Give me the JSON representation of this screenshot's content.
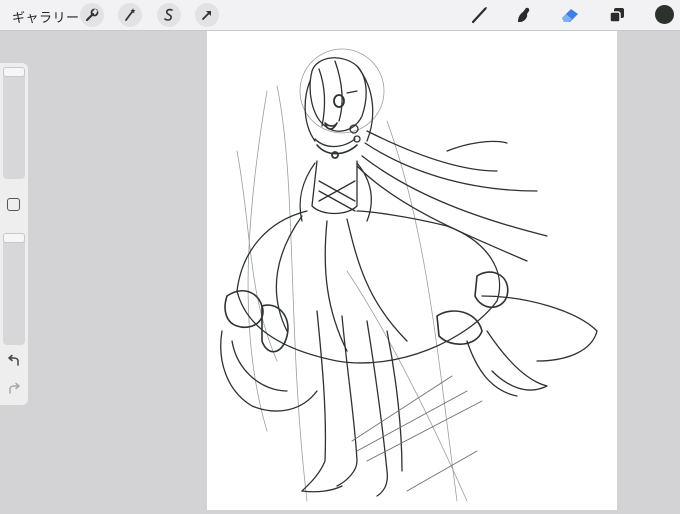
{
  "toolbar": {
    "gallery_label": "ギャラリー"
  },
  "colors": {
    "active_tool": "#3c7de6",
    "current_color": "#2b322e",
    "sketch_stroke": "#2d332f"
  },
  "icons": {
    "actions": "wrench-icon",
    "adjustments": "magic-wand-icon",
    "selection": "selection-s-icon",
    "transform": "arrow-cursor-icon",
    "brush": "brush-icon",
    "smudge": "smudge-finger-icon",
    "eraser": "eraser-icon",
    "layers": "layers-icon",
    "undo": "undo-arrow-icon",
    "redo": "redo-arrow-icon"
  }
}
